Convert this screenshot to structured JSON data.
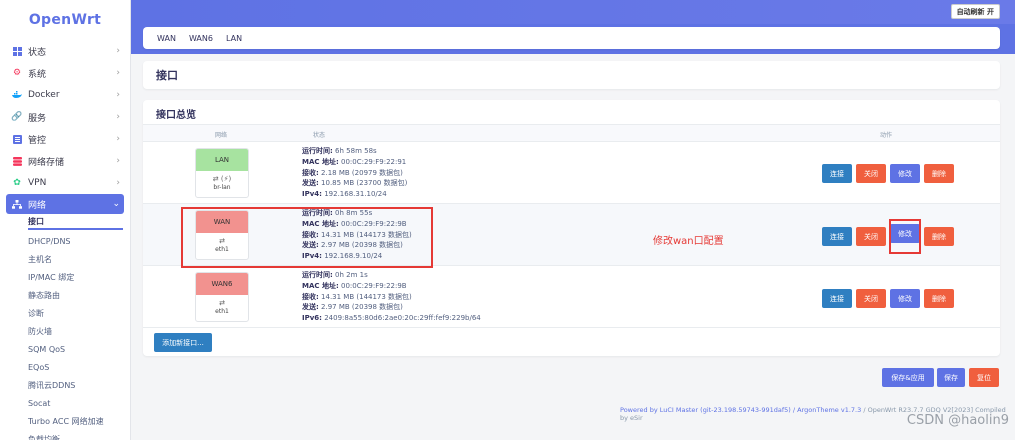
{
  "app": {
    "logo": "OpenWrt"
  },
  "header": {
    "refresh_label": "自动刷新 开"
  },
  "sidebar": {
    "items": [
      {
        "label": "状态",
        "icon": "dashboard-icon",
        "color": "#5e72e4"
      },
      {
        "label": "系统",
        "icon": "gear-icon",
        "color": "#f5365c"
      },
      {
        "label": "Docker",
        "icon": "docker-icon",
        "color": "#11a0f8"
      },
      {
        "label": "服务",
        "icon": "services-icon",
        "color": "#5e72e4"
      },
      {
        "label": "管控",
        "icon": "control-icon",
        "color": "#5e72e4"
      },
      {
        "label": "网络存储",
        "icon": "storage-icon",
        "color": "#f5365c"
      },
      {
        "label": "VPN",
        "icon": "vpn-icon",
        "color": "#2dce89"
      },
      {
        "label": "网络",
        "icon": "network-icon",
        "color": "#ffffff"
      }
    ],
    "network_sub": [
      "接口",
      "DHCP/DNS",
      "主机名",
      "IP/MAC 绑定",
      "静态路由",
      "诊断",
      "防火墙",
      "SQM QoS",
      "EQoS",
      "腾讯云DDNS",
      "Socat",
      "Turbo ACC 网络加速",
      "负载均衡"
    ]
  },
  "tabs": [
    "WAN",
    "WAN6",
    "LAN"
  ],
  "page_title": "接口",
  "overview": {
    "title": "接口总览",
    "col_network": "网络",
    "col_status": "状态",
    "col_actions": "动作",
    "rows": [
      {
        "name": "LAN",
        "color": "#a7e3a0",
        "icons": "⇄ (⚡)",
        "device": "br-lan",
        "uptime_label": "运行时间:",
        "uptime": "6h 58m 58s",
        "mac_label": "MAC 地址:",
        "mac": "00:0C:29:F9:22:91",
        "rx_label": "接收:",
        "rx": "2.18 MB (20979 数据包)",
        "tx_label": "发送:",
        "tx": "10.85 MB (23700 数据包)",
        "ip_label": "IPv4:",
        "ip": "192.168.31.10/24"
      },
      {
        "name": "WAN",
        "color": "#f2928f",
        "icons": "⇄",
        "device": "eth1",
        "uptime_label": "运行时间:",
        "uptime": "0h 8m 55s",
        "mac_label": "MAC 地址:",
        "mac": "00:0C:29:F9:22:9B",
        "rx_label": "接收:",
        "rx": "14.31 MB (144173 数据包)",
        "tx_label": "发送:",
        "tx": "2.97 MB (20398 数据包)",
        "ip_label": "IPv4:",
        "ip": "192.168.9.10/24"
      },
      {
        "name": "WAN6",
        "color": "#f2928f",
        "icons": "⇄",
        "device": "eth1",
        "uptime_label": "运行时间:",
        "uptime": "0h 2m 1s",
        "mac_label": "MAC 地址:",
        "mac": "00:0C:29:F9:22:9B",
        "rx_label": "接收:",
        "rx": "14.31 MB (144173 数据包)",
        "tx_label": "发送:",
        "tx": "2.97 MB (20398 数据包)",
        "ip_label": "IPv6:",
        "ip": "2409:8a55:80d6:2ae0:20c:29ff:fef9:229b/64"
      }
    ],
    "actions": {
      "connect": "连接",
      "stop": "关闭",
      "edit": "修改",
      "delete": "删除"
    },
    "add_label": "添加新接口..."
  },
  "annotation": {
    "text": "修改wan口配置",
    "color": "#e53935"
  },
  "bottom": {
    "save_apply": "保存&应用",
    "save": "保存",
    "reset": "复位"
  },
  "footer": {
    "luci": "Powered by LuCI Master (git-23.198.59743-991daf5)",
    "theme": " / ArgonTheme v1.7.3",
    "build": " / OpenWrt R23.7.7 GDQ V2[2023] Compiled by eSir"
  },
  "watermark": "CSDN @haolin9"
}
